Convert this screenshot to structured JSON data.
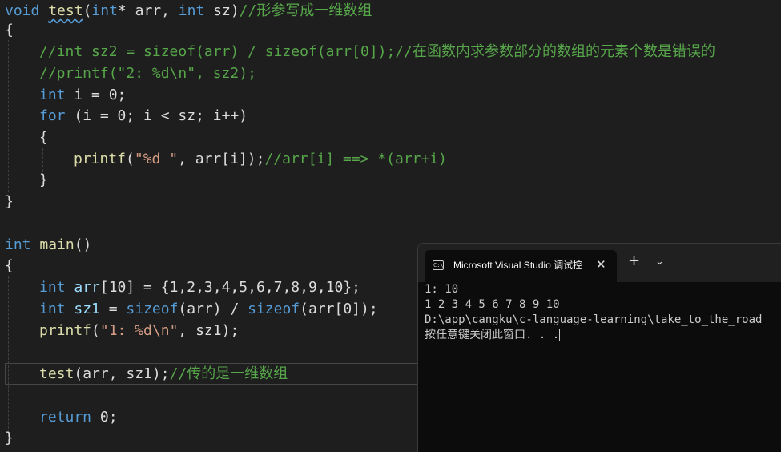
{
  "editor": {
    "lines": {
      "l1": {
        "kw": "void",
        "fn": "test",
        "p1": "(",
        "kw2": "int",
        "star": "*",
        "a": " arr, ",
        "kw3": "int",
        "b": " sz)",
        "cm": "//形参写成一维数组"
      },
      "l2": {
        "t": "{"
      },
      "l3": {
        "cm": "//int sz2 = sizeof(arr) / sizeof(arr[0]);//在函数内求参数部分的数组的元素个数是错误的"
      },
      "l4": {
        "cm": "//printf(\"2: %d\\n\", sz2);"
      },
      "l5": {
        "kw": "int",
        "rest": " i = 0;"
      },
      "l6": {
        "kw": "for",
        "rest": " (i = 0; i < sz; i++)"
      },
      "l7": {
        "t": "{"
      },
      "l8": {
        "fn": "printf",
        "p1": "(",
        "st": "\"%d \"",
        "rest": ", arr[i]);",
        "cm": "//arr[i] ==> *(arr+i)"
      },
      "l9": {
        "t": "}"
      },
      "l10": {
        "t": "}"
      },
      "l11": {
        "kw": "int",
        "fn": "main",
        "rest": "()"
      },
      "l12": {
        "t": "{"
      },
      "l13": {
        "kw": "int",
        "id": "arr",
        "rest": "[10] = {1,2,3,4,5,6,7,8,9,10};"
      },
      "l14": {
        "kw": "int",
        "id": "sz1",
        "a": " = ",
        "fn": "sizeof",
        "b": "(arr) / ",
        "fn2": "sizeof",
        "c": "(arr[0]);"
      },
      "l15": {
        "fn": "printf",
        "p1": "(",
        "st": "\"1: %d\\n\"",
        "rest": ", sz1);"
      },
      "l16": {
        "fn": "test",
        "rest": "(arr, sz1);",
        "cm": "//传的是一维数组"
      },
      "l17": {
        "kw": "return",
        "rest": " 0;"
      },
      "l18": {
        "t": "}"
      }
    }
  },
  "terminal": {
    "tab_title": "Microsoft Visual Studio 调试控",
    "tab_icon_text": "C:\\",
    "close_glyph": "✕",
    "new_tab_glyph": "+",
    "dropdown_glyph": "⌄",
    "output": [
      "1: 10",
      "1 2 3 4 5 6 7 8 9 10",
      "D:\\app\\cangku\\c-language-learning\\take_to_the_road",
      "按任意键关闭此窗口. . ."
    ]
  },
  "colors": {
    "keyword": "#569cd6",
    "function": "#dcdcaa",
    "comment": "#57a64a",
    "string": "#d69d85",
    "background": "#1e1e1e",
    "terminal_bg": "#0c0c0c"
  }
}
